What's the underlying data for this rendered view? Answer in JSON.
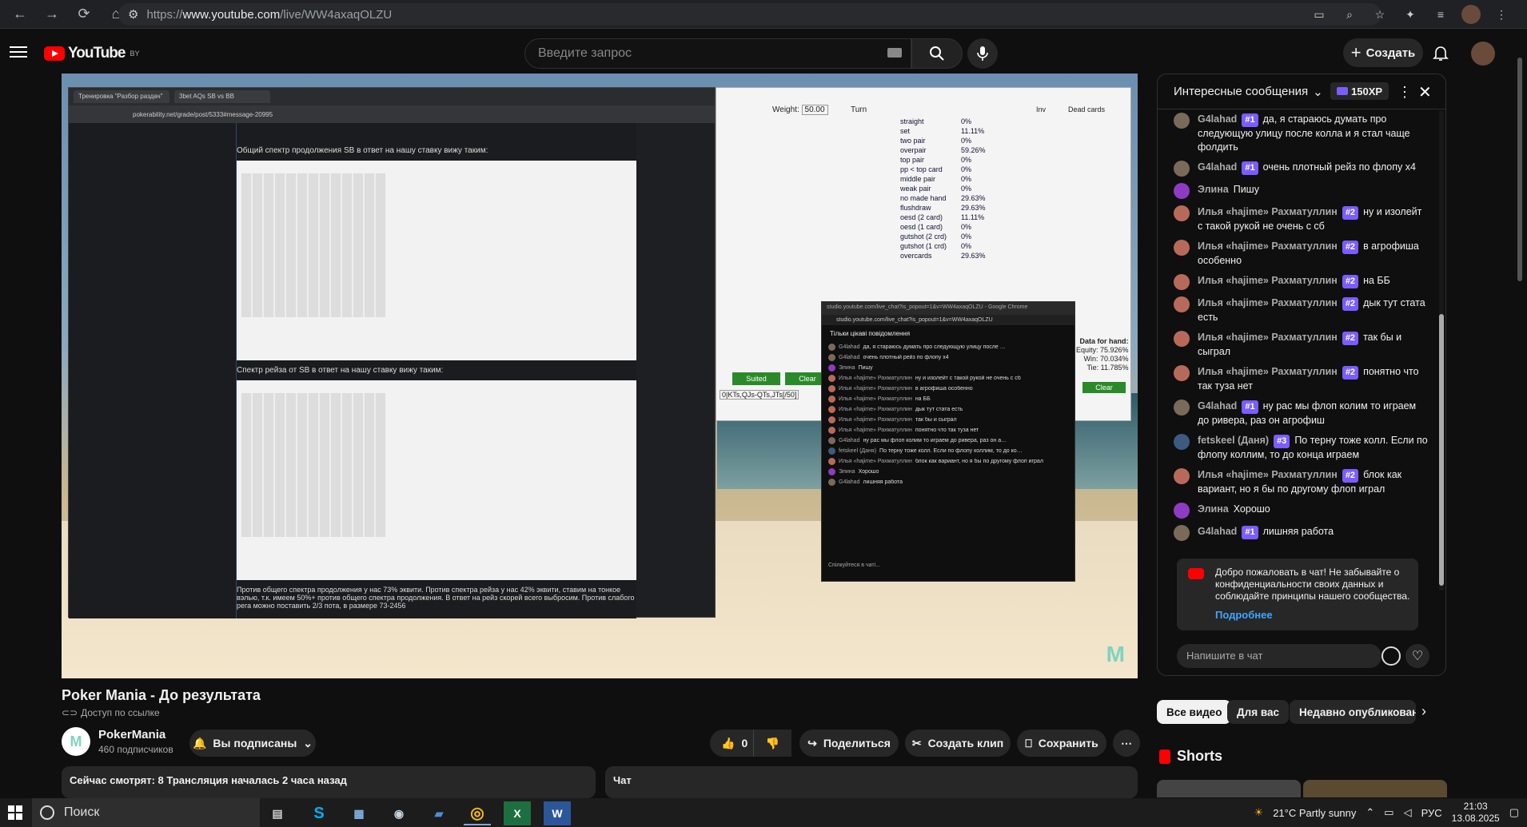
{
  "browser": {
    "url_prefix": "https://",
    "url_host": "www.youtube.com",
    "url_path": "/live/WW4axaqOLZU"
  },
  "header": {
    "logo_text": "YouTube",
    "region": "BY",
    "search_placeholder": "Введите запрос",
    "create_label": "Создать"
  },
  "video": {
    "window1": {
      "tab1": "Тренировка \"Разбор раздач\"",
      "tab2": "3bet AQs SB vs BB",
      "address": "pokerability.net/grade/post/5333#message-20995",
      "text1": "Общий спектр продолжения SB в ответ на нашу ставку вижу таким:",
      "text2": "Спектр рейза от SB в ответ на нашу ставку вижу таким:",
      "text3": "Против общего спектра продолжения у нас 73% эквити. Против спектра рейза у нас 42% эквити, ставим на тонкое вэлью, т.к. имеем 50%+ против общего спектра продолжения. В ответ на рейз скорей всего выбросим. Против слабого рега можно поставить 2/3 пота, в размере 73-2456"
    },
    "window2": {
      "weight_label": "Weight:",
      "weight_value": "50.00",
      "turn_label": "Turn",
      "dead_cards": "Dead cards",
      "inv": "Inv",
      "hands": [
        {
          "name": "straight",
          "pct": "0%"
        },
        {
          "name": "set",
          "pct": "11.11%"
        },
        {
          "name": "two pair",
          "pct": "0%"
        },
        {
          "name": "overpair",
          "pct": "59.26%"
        },
        {
          "name": "top pair",
          "pct": "0%"
        },
        {
          "name": "pp < top card",
          "pct": "0%"
        },
        {
          "name": "middle pair",
          "pct": "0%"
        },
        {
          "name": "weak pair",
          "pct": "0%"
        },
        {
          "name": "no made hand",
          "pct": "29.63%"
        },
        {
          "name": "flushdraw",
          "pct": "29.63%"
        },
        {
          "name": "oesd (2 card)",
          "pct": "11.11%"
        },
        {
          "name": "oesd (1 card)",
          "pct": "0%"
        },
        {
          "name": "gutshot (2 crd)",
          "pct": "0%"
        },
        {
          "name": "gutshot (1 crd)",
          "pct": "0%"
        },
        {
          "name": "overcards",
          "pct": "29.63%"
        }
      ],
      "suited_btn": "Suited",
      "clear_btn": "Clear",
      "range_text": "0|KTs,QJs-QTs,JTs[/50]",
      "data_for_hand": "Data for hand:",
      "equity": "Equity: 75.926%",
      "win": "Win: 70.034%",
      "tie": "Tie: 11.785%",
      "clear2": "Clear"
    },
    "window3": {
      "title": "studio.youtube.com/live_chat?is_popout=1&v=WW4axaqOLZU - Google Chrome",
      "address": "studio.youtube.com/live_chat?is_popout=1&v=WW4axaqOLZU",
      "header": "Тільки цікаві повідомлення",
      "input": "Спілкуйтеся в чаті..."
    }
  },
  "below": {
    "title": "Poker Mania - До результата",
    "access": "Доступ по ссылке",
    "channel_initial": "M",
    "channel_name": "PokerMania",
    "channel_subs": "460 подписчиков",
    "subscribed_label": "Вы подписаны",
    "like_count": "0",
    "share_label": "Поделиться",
    "clip_label": "Создать клип",
    "save_label": "Сохранить",
    "info_line": "Сейчас смотрят: 8  Трансляция началась 2 часа назад",
    "chat_label": "Чат"
  },
  "chat": {
    "header": "Интересные сообщения",
    "xp": "150XP",
    "messages": [
      {
        "name": "G4lahad",
        "badge": "#1",
        "text": "да, я стараюсь думать про следующую улицу после колла и я стал чаще фолдить",
        "color": "#7a6a5a"
      },
      {
        "name": "G4lahad",
        "badge": "#1",
        "text": "очень плотный рейз по флопу х4",
        "color": "#7a6a5a"
      },
      {
        "name": "Элина",
        "badge": "",
        "text": "Пишу",
        "color": "#8e3bc4"
      },
      {
        "name": "Илья «hajime» Рахматуллин",
        "badge": "#2",
        "text": "ну и изолейт с такой рукой не очень с сб",
        "color": "#b86a5a"
      },
      {
        "name": "Илья «hajime» Рахматуллин",
        "badge": "#2",
        "text": "в агрофиша особенно",
        "color": "#b86a5a"
      },
      {
        "name": "Илья «hajime» Рахматуллин",
        "badge": "#2",
        "text": "на ББ",
        "color": "#b86a5a"
      },
      {
        "name": "Илья «hajime» Рахматуллин",
        "badge": "#2",
        "text": "дык тут стата есть",
        "color": "#b86a5a"
      },
      {
        "name": "Илья «hajime» Рахматуллин",
        "badge": "#2",
        "text": "так бы и сыграл",
        "color": "#b86a5a"
      },
      {
        "name": "Илья «hajime» Рахматуллин",
        "badge": "#2",
        "text": "понятно что так туза нет",
        "color": "#b86a5a"
      },
      {
        "name": "G4lahad",
        "badge": "#1",
        "text": "ну рас мы флоп колим то играем до ривера, раз он агрофиш",
        "color": "#7a6a5a"
      },
      {
        "name": "fetskeel (Даня)",
        "badge": "#3",
        "text": "По терну тоже колл. Если по флопу коллим, то до конца играем",
        "color": "#3d5a80"
      },
      {
        "name": "Илья «hajime» Рахматуллин",
        "badge": "#2",
        "text": "блок как вариант, но я бы по другому флоп играл",
        "color": "#b86a5a"
      },
      {
        "name": "Элина",
        "badge": "",
        "text": "Хорошо",
        "color": "#8e3bc4"
      },
      {
        "name": "G4lahad",
        "badge": "#1",
        "text": "лишняя работа",
        "color": "#7a6a5a"
      }
    ],
    "welcome": "Добро пожаловать в чат! Не забывайте о конфиденциальности своих данных и соблюдайте принципы нашего сообщества.",
    "welcome_more": "Подробнее",
    "input_placeholder": "Напишите в чат"
  },
  "chips": {
    "all": "Все видео",
    "for_you": "Для вас",
    "recent": "Недавно опубликованн",
    "shorts": "Shorts"
  },
  "taskbar": {
    "search": "Поиск",
    "weather": "21°C  Partly sunny",
    "lang": "РУС",
    "time": "21:03",
    "date": "13.08.2025"
  }
}
